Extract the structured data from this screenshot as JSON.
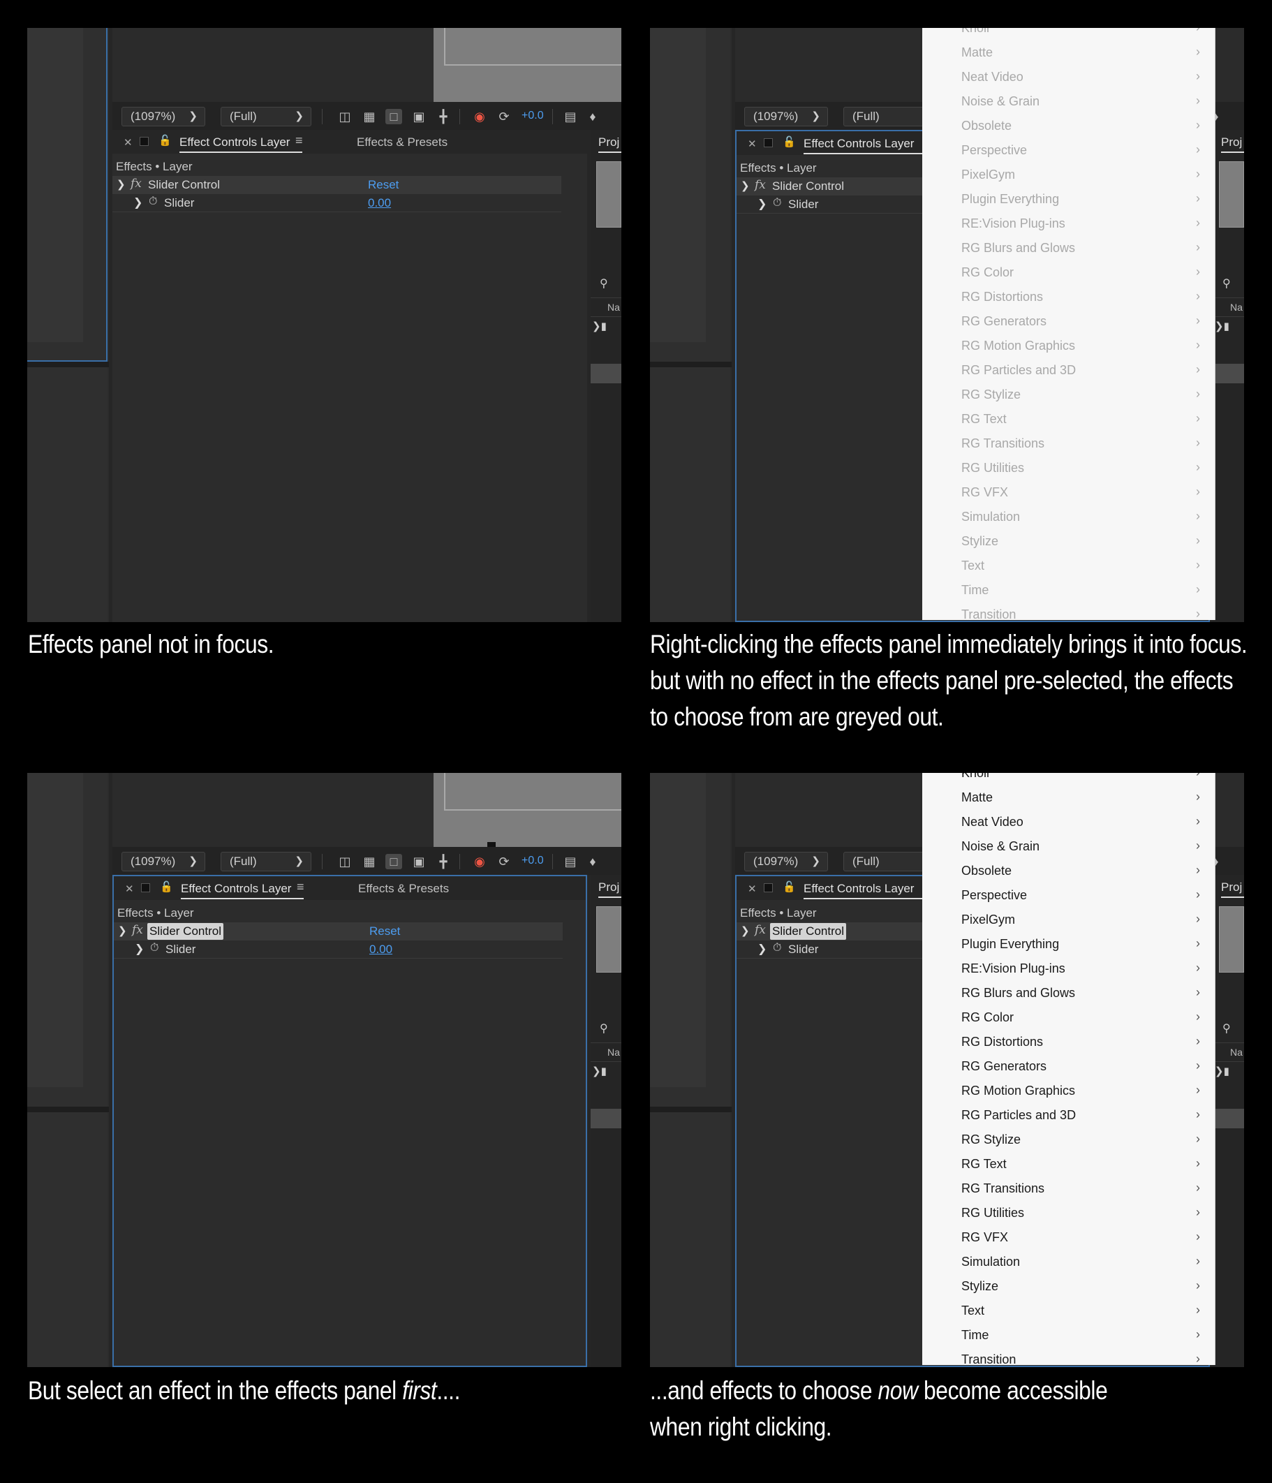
{
  "panel": {
    "zoom": "(1097%)",
    "resolution": "(Full)",
    "exposure": "+0.0",
    "tab_effect_controls": "Effect Controls Layer",
    "tab_effects_presets": "Effects & Presets",
    "breadcrumb": "Effects • Layer",
    "effect_name": "Slider Control",
    "reset_label": "Reset",
    "property_name": "Slider",
    "property_value": "0.00",
    "project_tab": "Proj",
    "project_col": "Na"
  },
  "menu_items": [
    "Knoll",
    "Matte",
    "Neat Video",
    "Noise & Grain",
    "Obsolete",
    "Perspective",
    "PixelGym",
    "Plugin Everything",
    "RE:Vision Plug-ins",
    "RG Blurs and Glows",
    "RG Color",
    "RG Distortions",
    "RG Generators",
    "RG Motion Graphics",
    "RG Particles and 3D",
    "RG Stylize",
    "RG Text",
    "RG Transitions",
    "RG Utilities",
    "RG VFX",
    "Simulation",
    "Stylize",
    "Text",
    "Time",
    "Transition"
  ],
  "captions": {
    "c1": "Effects panel not in focus.",
    "c2_l1": "Right-clicking the effects panel immediately brings it into focus.",
    "c2_l2": "but with no effect in the effects panel pre-selected, the effects",
    "c2_l3": "to choose from are greyed out.",
    "c3_a": "But select an effect in the effects panel ",
    "c3_em": "first",
    "c3_b": "....",
    "c4_a": "...and effects to choose ",
    "c4_em": "now",
    "c4_b": " become accessible",
    "c4_l2": "when right clicking."
  },
  "colors": {
    "accent_blue": "#4d9df0",
    "focus_border": "#3a6fa8",
    "menu_bg": "#f7f7f7",
    "menu_disabled_text": "#a8a8a8",
    "menu_enabled_text": "#1a1a1a"
  }
}
